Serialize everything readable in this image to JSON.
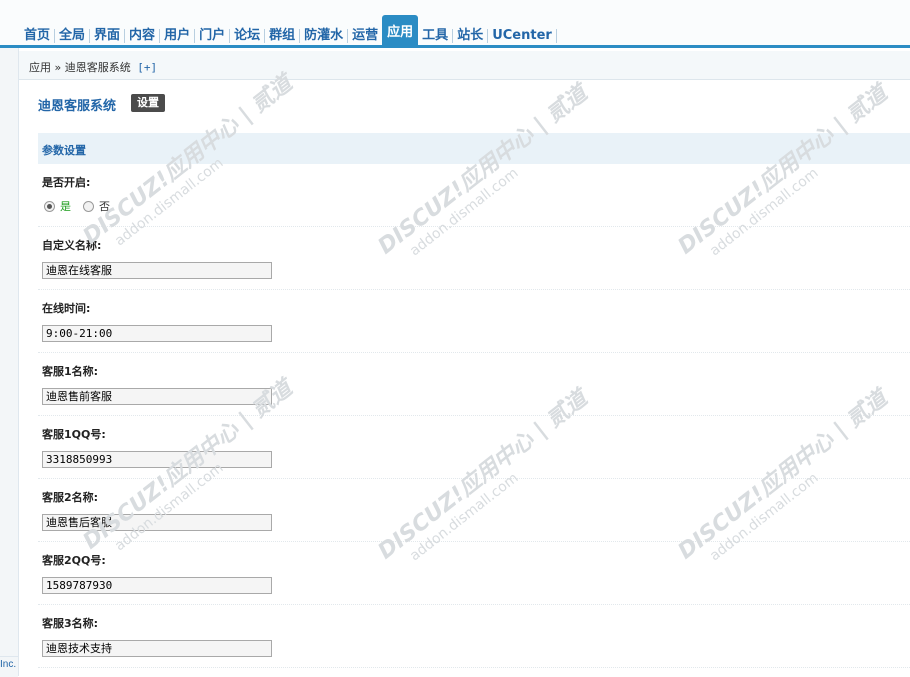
{
  "nav": {
    "items": [
      "首页",
      "全局",
      "界面",
      "内容",
      "用户",
      "门户",
      "论坛",
      "群组",
      "防灌水",
      "运营",
      "应用",
      "工具",
      "站长",
      "UCenter"
    ],
    "active": "应用"
  },
  "breadcrumb": {
    "path": "应用 » 迪恩客服系统",
    "add": "[+]"
  },
  "plugin": {
    "title": "迪恩客服系统",
    "tab": "设置"
  },
  "section": {
    "title": "参数设置"
  },
  "enable": {
    "label": "是否开启:",
    "yes": "是",
    "no": "否"
  },
  "fields": [
    {
      "label": "自定义名称:",
      "value": "迪恩在线客服"
    },
    {
      "label": "在线时间:",
      "value": "9:00-21:00"
    },
    {
      "label": "客服1名称:",
      "value": "迪恩售前客服"
    },
    {
      "label": "客服1QQ号:",
      "value": "3318850993"
    },
    {
      "label": "客服2名称:",
      "value": "迪恩售后客服"
    },
    {
      "label": "客服2QQ号:",
      "value": "1589787930"
    },
    {
      "label": "客服3名称:",
      "value": "迪恩技术支持"
    }
  ],
  "footer": {
    "fragment": "Inc."
  },
  "watermark": {
    "line1": "DISCUZ!应用中心 | 贰道",
    "line2": "addon.dismall.com"
  },
  "colors": {
    "accent": "#2b8cc4",
    "link": "#2366a8",
    "section_bg": "#e9f2f8",
    "tab_bg": "#4b4b4b"
  }
}
